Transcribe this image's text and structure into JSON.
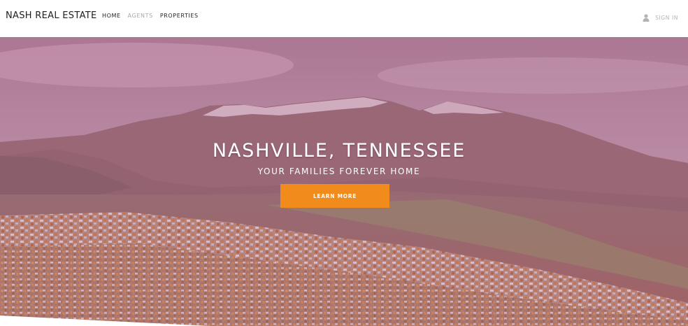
{
  "header": {
    "brand": "NASH REAL ESTATE",
    "nav": [
      {
        "label": "HOME"
      },
      {
        "label": "AGENTS"
      },
      {
        "label": "PROPERTIES"
      }
    ],
    "signin_label": "SIGN IN",
    "signin_icon": "user-icon"
  },
  "hero": {
    "title": "NASHVILLE, TENNESSEE",
    "subtitle": "YOUR FAMILIES FOREVER HOME",
    "cta_label": "LEARN MORE",
    "overlay_color": "#b46e96"
  },
  "colors": {
    "accent": "#f08b1c",
    "text": "#1f1f1f",
    "muted": "#a8a8a8",
    "white": "#ffffff"
  }
}
